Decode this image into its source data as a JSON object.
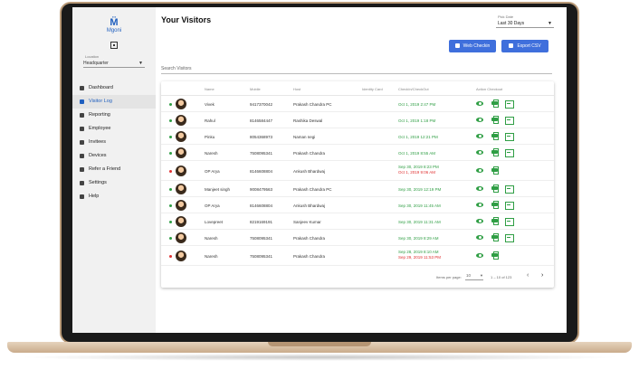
{
  "app": {
    "logo_mark": "M̈",
    "logo_text": "Mgoni"
  },
  "sidebar": {
    "location_label": "Location",
    "location_value": "Headquarter",
    "items": [
      {
        "label": "Dashboard",
        "icon": "dashboard-icon"
      },
      {
        "label": "Visitor Log",
        "icon": "person-icon",
        "active": true
      },
      {
        "label": "Reporting",
        "icon": "report-icon"
      },
      {
        "label": "Employee",
        "icon": "employee-icon"
      },
      {
        "label": "Invitees",
        "icon": "mail-icon"
      },
      {
        "label": "Devices",
        "icon": "device-icon"
      },
      {
        "label": "Refer a Friend",
        "icon": "share-icon"
      },
      {
        "label": "Settings",
        "icon": "wrench-icon"
      },
      {
        "label": "Help",
        "icon": "help-icon"
      }
    ]
  },
  "header": {
    "title": "Your Visitors",
    "filter_label": "Pick Date",
    "filter_value": "Last 30 Days",
    "web_checkin_label": "Web Checkin",
    "export_label": "Export CSV",
    "search_placeholder": "Search Visitors"
  },
  "table": {
    "columns": [
      "Name",
      "Mobile",
      "Host",
      "Identity Card",
      "CheckIn/CheckOut",
      "Action Checkout"
    ],
    "rows": [
      {
        "status": "green",
        "name": "Vivek",
        "mobile": "9417370042",
        "host": "Prakash Chandra PC",
        "checkin": "Oct 1, 2019 2:47 PM",
        "checkout": "",
        "checkout_action": true
      },
      {
        "status": "green",
        "name": "Rahul",
        "mobile": "8146584447",
        "host": "Rashika Deswal",
        "checkin": "Oct 1, 2019 1:18 PM",
        "checkout": "",
        "checkout_action": true
      },
      {
        "status": "green",
        "name": "Pinku",
        "mobile": "8054368973",
        "host": "Naman negi",
        "checkin": "Oct 1, 2019 12:21 PM",
        "checkout": "",
        "checkout_action": true
      },
      {
        "status": "green",
        "name": "Naresh",
        "mobile": "7508095341",
        "host": "Prakash Chandra",
        "checkin": "Oct 1, 2019 8:55 AM",
        "checkout": "",
        "checkout_action": true
      },
      {
        "status": "red",
        "name": "OP Arya",
        "mobile": "8146608804",
        "host": "Ankush Bhardwaj",
        "checkin": "Sep 30, 2019 8:23 PM",
        "checkout": "Oct 1, 2019 9:06 AM",
        "checkout_action": false
      },
      {
        "status": "green",
        "name": "Manjeet singh",
        "mobile": "9008479563",
        "host": "Prakash Chandra PC",
        "checkin": "Sep 30, 2019 12:19 PM",
        "checkout": "",
        "checkout_action": true
      },
      {
        "status": "green",
        "name": "OP Arya",
        "mobile": "8146608804",
        "host": "Ankush Bhardwaj",
        "checkin": "Sep 30, 2019 11:45 AM",
        "checkout": "",
        "checkout_action": true
      },
      {
        "status": "green",
        "name": "Lovepreet",
        "mobile": "8219169191",
        "host": "Sanjeev Kumar",
        "checkin": "Sep 30, 2019 11:31 AM",
        "checkout": "",
        "checkout_action": true
      },
      {
        "status": "green",
        "name": "Naresh",
        "mobile": "7508095341",
        "host": "Prakash Chandra",
        "checkin": "Sep 30, 2019 8:29 AM",
        "checkout": "",
        "checkout_action": true
      },
      {
        "status": "red",
        "name": "Naresh",
        "mobile": "7508095341",
        "host": "Prakash Chandra",
        "checkin": "Sep 28, 2019 8:10 AM",
        "checkout": "Sep 29, 2019 11:53 PM",
        "checkout_action": false
      }
    ]
  },
  "pagination": {
    "items_label": "Items per page:",
    "per_page": "10",
    "range": "1 – 10 of 123",
    "prev": "‹",
    "next": "›"
  },
  "colors": {
    "accent": "#3f6fdc",
    "checkin": "#2f9e44",
    "checkout": "#e03131"
  }
}
